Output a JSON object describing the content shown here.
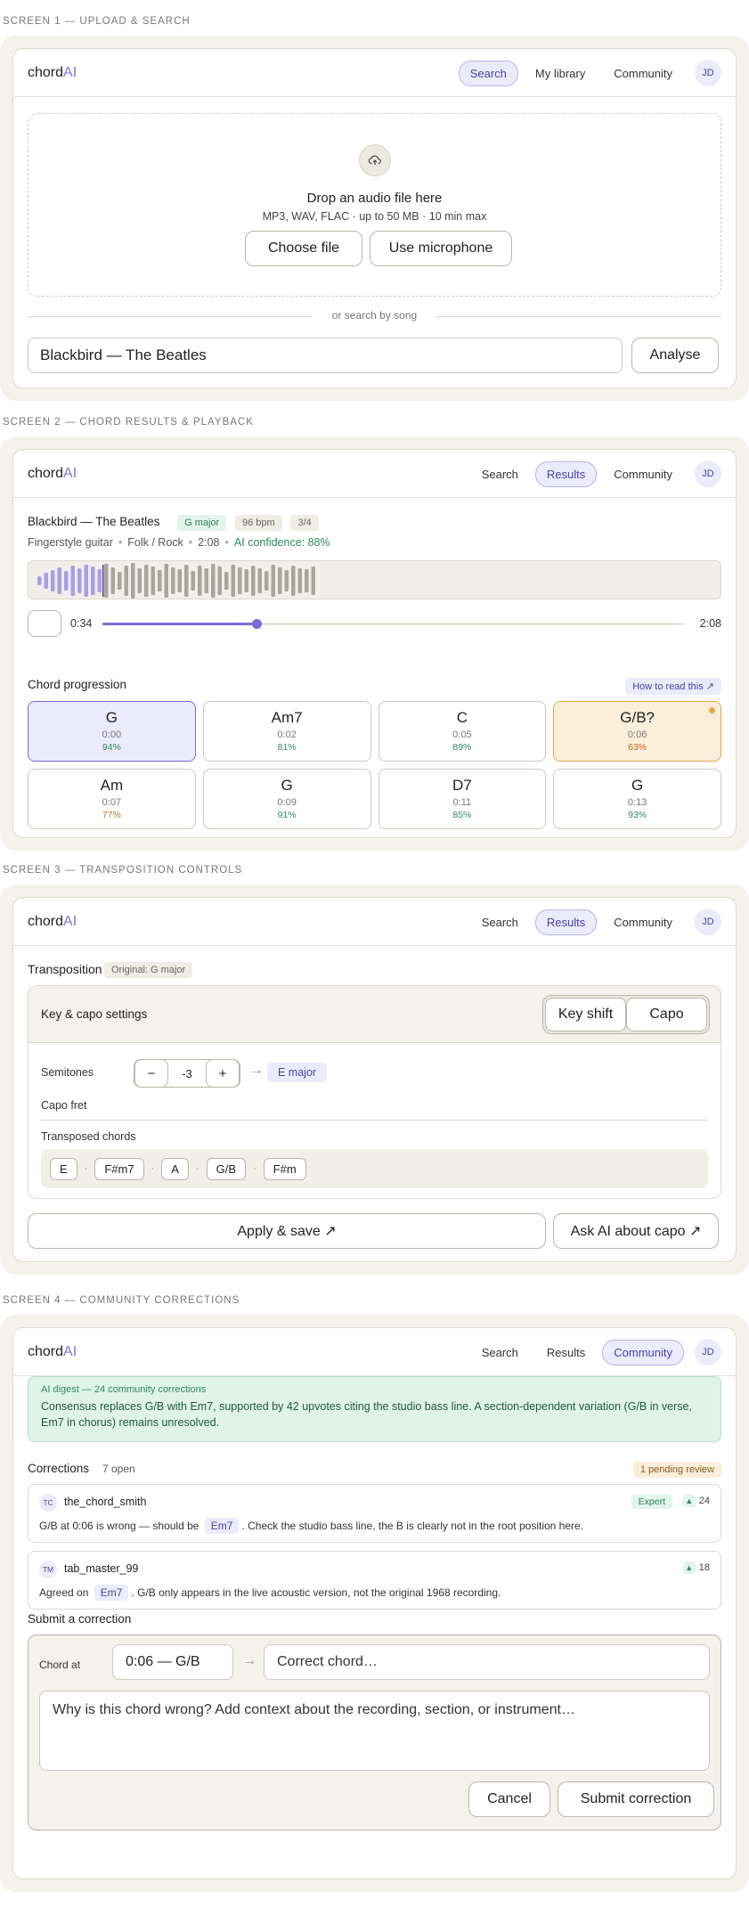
{
  "logo": {
    "text": "chord",
    "accent": "AI"
  },
  "user_initials": "JD",
  "screen1": {
    "label": "SCREEN 1 — UPLOAD & SEARCH",
    "nav": [
      "Search",
      "My library",
      "Community"
    ],
    "drop_title": "Drop an audio file here",
    "drop_sub": "MP3, WAV, FLAC · up to 50 MB · 10 min max",
    "choose_file": "Choose file",
    "use_mic": "Use microphone",
    "or_search": "or search by song",
    "search_value": "Blackbird — The Beatles",
    "analyse": "Analyse"
  },
  "screen2": {
    "label": "SCREEN 2 — CHORD RESULTS & PLAYBACK",
    "nav": [
      "Search",
      "Results",
      "Community"
    ],
    "song": "Blackbird — The Beatles",
    "key_tag": "G major",
    "bpm_tag": "96 bpm",
    "time_sig_tag": "3/4",
    "instrument": "Fingerstyle guitar",
    "genre": "Folk / Rock",
    "duration": "2:08",
    "confidence": "AI confidence: 88%",
    "current_time": "0:34",
    "total_time": "2:08",
    "playback_fraction": 0.265,
    "progression_title": "Chord progression",
    "how_to_read": "How to read this ↗",
    "chords": [
      {
        "name": "G",
        "time": "0:00",
        "conf": "94%",
        "state": "selected"
      },
      {
        "name": "Am7",
        "time": "0:02",
        "conf": "81%",
        "state": "normal"
      },
      {
        "name": "C",
        "time": "0:05",
        "conf": "89%",
        "state": "normal"
      },
      {
        "name": "G/B?",
        "time": "0:06",
        "conf": "63%",
        "state": "uncertain"
      },
      {
        "name": "Am",
        "time": "0:07",
        "conf": "77%",
        "state": "normal"
      },
      {
        "name": "G",
        "time": "0:09",
        "conf": "91%",
        "state": "normal"
      },
      {
        "name": "D7",
        "time": "0:11",
        "conf": "85%",
        "state": "normal"
      },
      {
        "name": "G",
        "time": "0:13",
        "conf": "93%",
        "state": "normal"
      }
    ],
    "colors": {
      "high": "#2f8a5e",
      "mid": "#b07a2a",
      "low": "#c0601f",
      "accent": "#7a6ad6"
    }
  },
  "screen3": {
    "label": "SCREEN 3 — TRANSPOSITION CONTROLS",
    "nav": [
      "Search",
      "Results",
      "Community"
    ],
    "title": "Transposition",
    "original": "Original: G major",
    "panel_title": "Key & capo settings",
    "seg": [
      "Key shift",
      "Capo"
    ],
    "semitones_label": "Semitones",
    "minus": "−",
    "semitones_value": "-3",
    "plus": "+",
    "arrow": "→",
    "result_key": "E major",
    "capo_label": "Capo fret",
    "transposed_label": "Transposed chords",
    "transposed": [
      "E",
      "F#m7",
      "A",
      "G/B",
      "F#m"
    ],
    "apply": "Apply & save ↗",
    "ask_ai": "Ask AI about capo ↗"
  },
  "screen4": {
    "label": "SCREEN 4 — COMMUNITY CORRECTIONS",
    "nav": [
      "Search",
      "Results",
      "Community"
    ],
    "digest_head": "AI digest — 24 community corrections",
    "digest_body": "Consensus replaces G/B with Em7, supported by 42 upvotes citing the studio bass line. A section-dependent variation (G/B in verse, Em7 in chorus) remains unresolved.",
    "corrections_title": "Corrections",
    "open_count": "7 open",
    "pending": "1 pending review",
    "corrections": [
      {
        "initials": "TC",
        "user": "the_chord_smith",
        "badge": "Expert",
        "votes": "24",
        "pre": "G/B at 0:06 is wrong — should be",
        "chip": "Em7",
        "post": ". Check the studio bass line, the B is clearly not in the root position here."
      },
      {
        "initials": "TM",
        "user": "tab_master_99",
        "badge": "",
        "votes": "18",
        "pre": "Agreed on",
        "chip": "Em7",
        "post": ". G/B only appears in the live acoustic version, not the original 1968 recording."
      }
    ],
    "submit_title": "Submit a correction",
    "chord_at_label": "Chord at",
    "chord_at_value": "0:06 — G/B",
    "arrow": "→",
    "correct_placeholder": "Correct chord…",
    "reason_placeholder": "Why is this chord wrong? Add context about the recording, section, or instrument…",
    "cancel": "Cancel",
    "submit": "Submit correction"
  }
}
